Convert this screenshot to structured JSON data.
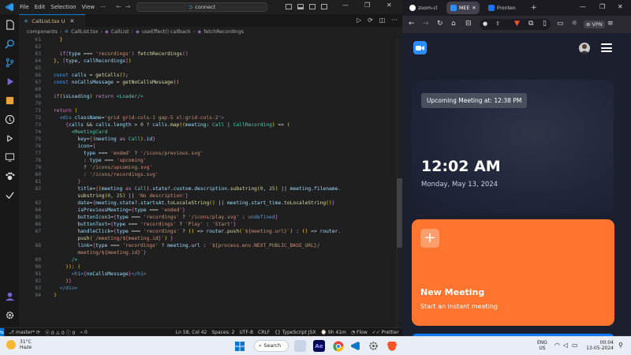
{
  "vscode": {
    "menu": [
      "File",
      "Edit",
      "Selection",
      "View"
    ],
    "command_center": "connect",
    "tab": {
      "label": "CallList.tsx U"
    },
    "breadcrumb": [
      "components",
      "CallList.tsx",
      "CallList",
      "useEffect() callback",
      "fetchRecordings"
    ],
    "status": {
      "branch": "master*",
      "errors": "0",
      "warnings": "0",
      "info": "0",
      "remote": "0",
      "position": "Ln 58, Col 42",
      "spaces": "Spaces: 2",
      "encoding": "UTF-8",
      "eol": "CRLF",
      "language": "TypeScript JSX",
      "time": "9h 41m",
      "flow": "Flow",
      "prettier": "Prettier"
    },
    "line_numbers": [
      "61",
      "62",
      "63",
      "64",
      "65",
      "66",
      "67",
      "68",
      "69",
      "70",
      "71",
      "72",
      "73",
      "74",
      "75",
      "76",
      "77",
      "78",
      "79",
      "80",
      "81",
      "82",
      "",
      "83",
      "84",
      "85",
      "86",
      "87",
      "",
      "88",
      "",
      "89",
      "90",
      "91",
      "92",
      "93",
      "94"
    ]
  },
  "browser": {
    "tabs": [
      "zoom-cl",
      "MEE",
      "Fronten"
    ],
    "vpn_label": "VPN",
    "page": {
      "upcoming": "Upcoming Meeting at: 12:38 PM",
      "time": "12:02 AM",
      "date": "Monday, May 13, 2024",
      "card_plus": "+",
      "card_title": "New Meeting",
      "card_subtitle": "Start an instant meeting"
    }
  },
  "taskbar": {
    "temperature": "31°C",
    "weather": "Haze",
    "search": "Search",
    "lang1": "ENG",
    "lang2": "US",
    "time": "00:04",
    "date": "13-05-2024"
  }
}
